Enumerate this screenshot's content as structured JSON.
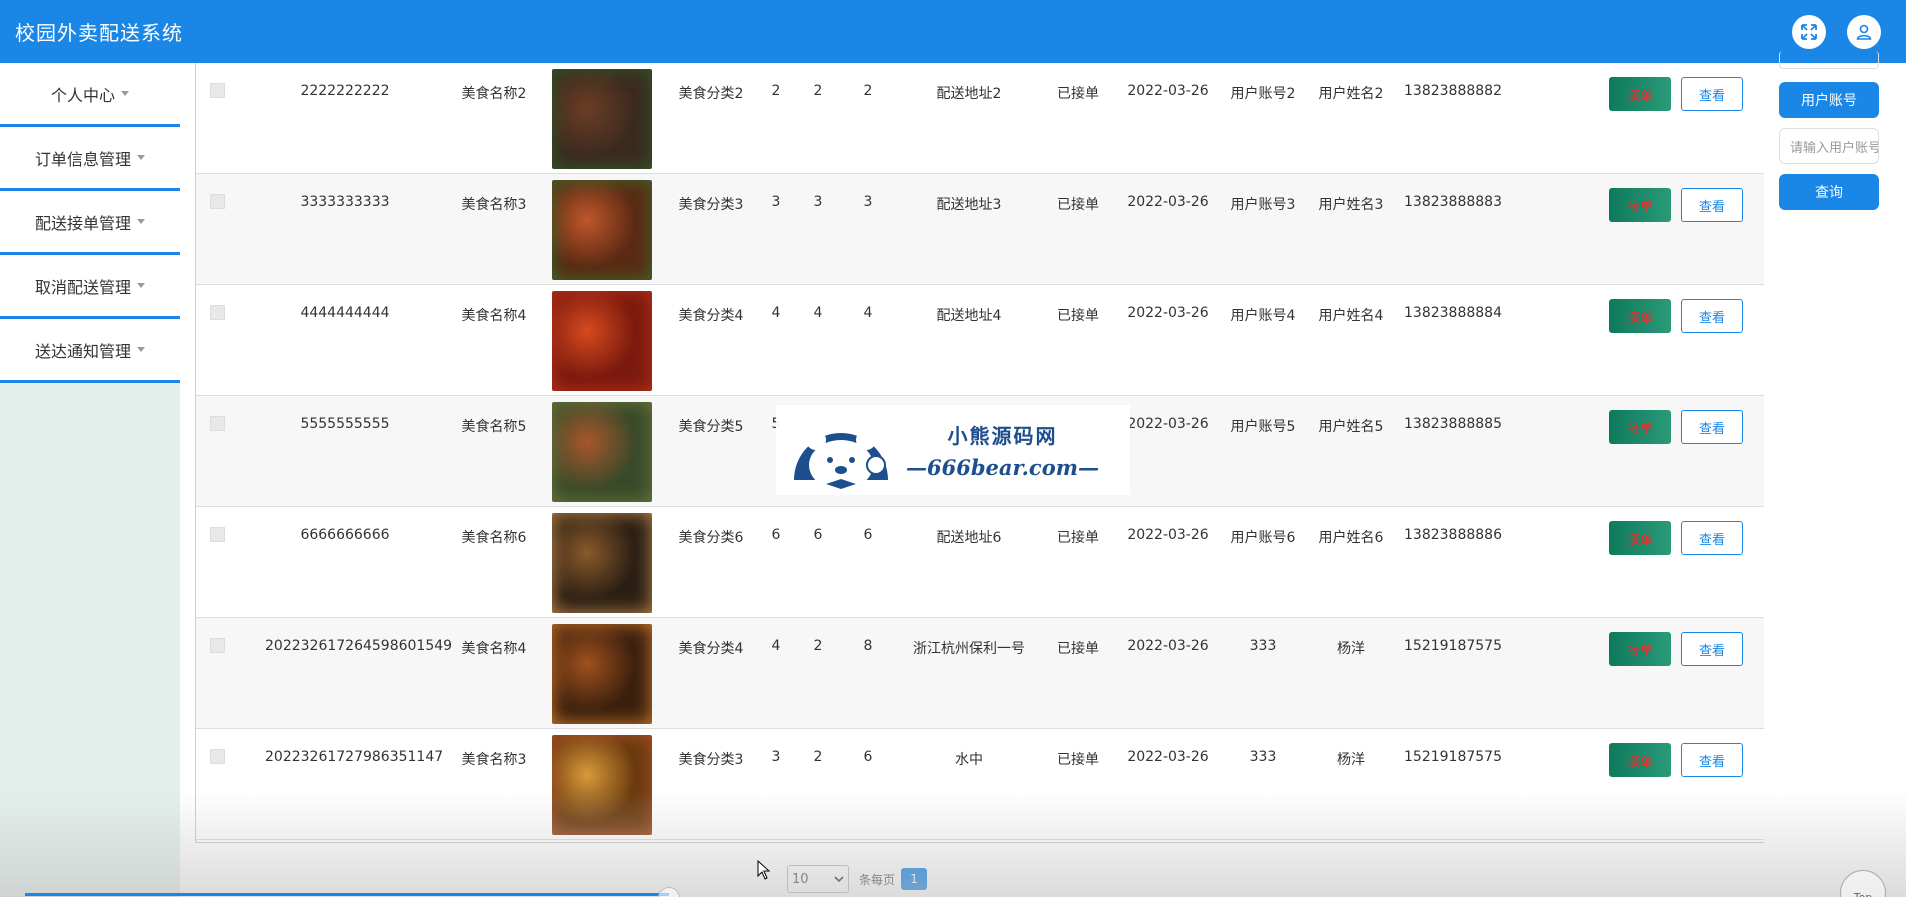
{
  "app": {
    "title": "校园外卖配送系统"
  },
  "sidebar": {
    "items": [
      {
        "label": "个人中心"
      },
      {
        "label": "订单信息管理"
      },
      {
        "label": "配送接单管理"
      },
      {
        "label": "取消配送管理"
      },
      {
        "label": "送达通知管理"
      }
    ]
  },
  "search_panel": {
    "label_button": "用户账号",
    "input_placeholder": "请输入用户账号",
    "search_button": "查询"
  },
  "table": {
    "rows": [
      {
        "order_no": "2222222222",
        "food_name": "美食名称2",
        "category": "美食分类2",
        "price": "2",
        "qty": "2",
        "total": "2",
        "address": "配送地址2",
        "status": "已接单",
        "date": "2022-03-26",
        "account": "用户账号2",
        "user_name": "用户姓名2",
        "phone": "13823888882",
        "food_image": "braised-meat-image",
        "accept_label": "接单",
        "view_label": "查看"
      },
      {
        "order_no": "3333333333",
        "food_name": "美食名称3",
        "category": "美食分类3",
        "price": "3",
        "qty": "3",
        "total": "3",
        "address": "配送地址3",
        "status": "已接单",
        "date": "2022-03-26",
        "account": "用户账号3",
        "user_name": "用户姓名3",
        "phone": "13823888883",
        "food_image": "shrimp-image",
        "accept_label": "接单",
        "view_label": "查看"
      },
      {
        "order_no": "4444444444",
        "food_name": "美食名称4",
        "category": "美食分类4",
        "price": "4",
        "qty": "4",
        "total": "4",
        "address": "配送地址4",
        "status": "已接单",
        "date": "2022-03-26",
        "account": "用户账号4",
        "user_name": "用户姓名4",
        "phone": "13823888884",
        "food_image": "hotpot-image",
        "accept_label": "接单",
        "view_label": "查看"
      },
      {
        "order_no": "5555555555",
        "food_name": "美食名称5",
        "category": "美食分类5",
        "price": "5",
        "qty": "",
        "total": "",
        "address": "",
        "status": "",
        "date": "2022-03-26",
        "account": "用户账号5",
        "user_name": "用户姓名5",
        "phone": "13823888885",
        "food_image": "salad-bowl-image",
        "accept_label": "接单",
        "view_label": "查看"
      },
      {
        "order_no": "6666666666",
        "food_name": "美食名称6",
        "category": "美食分类6",
        "price": "6",
        "qty": "6",
        "total": "6",
        "address": "配送地址6",
        "status": "已接单",
        "date": "2022-03-26",
        "account": "用户账号6",
        "user_name": "用户姓名6",
        "phone": "13823888886",
        "food_image": "table-dishes-image",
        "accept_label": "接单",
        "view_label": "查看"
      },
      {
        "order_no": "20223261726459860154​9",
        "food_name": "美食名称4",
        "category": "美食分类4",
        "price": "4",
        "qty": "2",
        "total": "8",
        "address": "浙江杭州保利一号",
        "status": "已接单",
        "date": "2022-03-26",
        "account": "333",
        "user_name": "杨洋",
        "phone": "15219187575",
        "food_image": "grilled-fish-image",
        "accept_label": "接单",
        "view_label": "查看"
      },
      {
        "order_no": "20223261727986351147",
        "food_name": "美食名称3",
        "category": "美食分类3",
        "price": "3",
        "qty": "2",
        "total": "6",
        "address": "水中",
        "status": "已接单",
        "date": "2022-03-26",
        "account": "333",
        "user_name": "杨洋",
        "phone": "15219187575",
        "food_image": "skewers-image",
        "accept_label": "接单",
        "view_label": "查看"
      }
    ]
  },
  "pagination": {
    "page_size": "10",
    "per_page_label": "条每页",
    "current_page": "1"
  },
  "watermark": {
    "cn": "小熊源码网",
    "en": "—666bear.com—"
  },
  "top_button": {
    "label": "Top"
  },
  "colors": {
    "header": "#1a86e6",
    "accept_button": "#0d7a5c",
    "accent": "#1a86e6"
  }
}
